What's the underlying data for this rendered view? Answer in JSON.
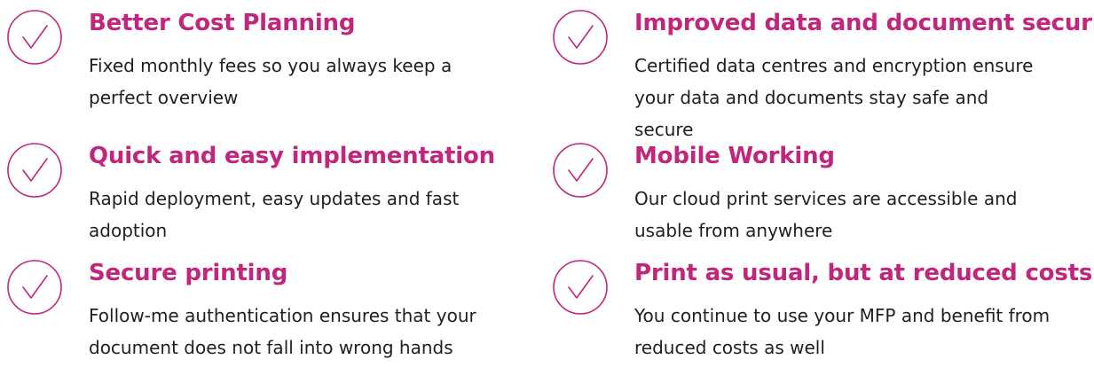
{
  "colors": {
    "accent": "#c0267b",
    "text": "#1f1f1f"
  },
  "features": [
    {
      "icon": "check-circle-icon",
      "title": "Better Cost Planning",
      "description": "Fixed monthly fees so you always keep a perfect overview"
    },
    {
      "icon": "check-circle-icon",
      "title": "Improved data and document security",
      "description": "Certified data centres and encryption ensure your data and documents stay safe and secure"
    },
    {
      "icon": "check-circle-icon",
      "title": "Quick and easy implementation",
      "description": "Rapid deployment, easy updates and fast adoption"
    },
    {
      "icon": "check-circle-icon",
      "title": "Mobile Working",
      "description": "Our cloud print services are accessible and usable from anywhere"
    },
    {
      "icon": "check-circle-icon",
      "title": "Secure printing",
      "description": "Follow-me authentication ensures that your document does not fall into wrong hands"
    },
    {
      "icon": "check-circle-icon",
      "title": "Print as usual, but at reduced costs",
      "description": "You continue to use your MFP and benefit  from reduced costs as well"
    }
  ]
}
